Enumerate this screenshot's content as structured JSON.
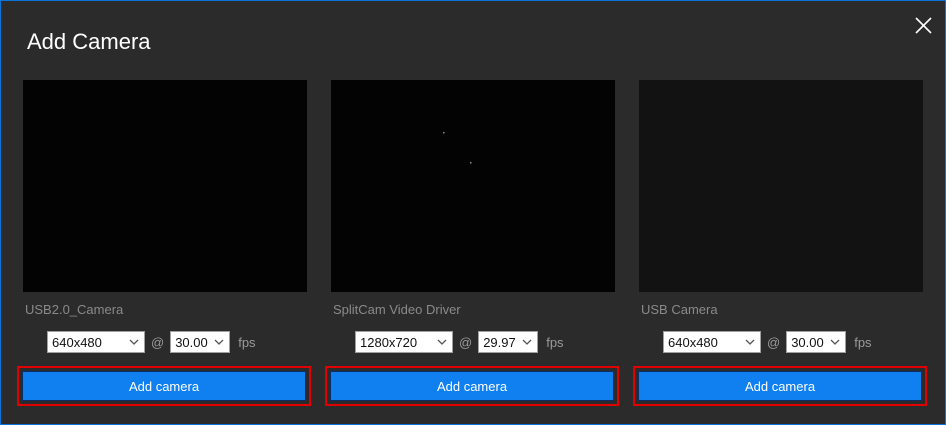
{
  "dialog": {
    "title": "Add Camera",
    "close_icon": "close-icon",
    "accent_color": "#1080f0",
    "highlight_color": "#e00000"
  },
  "cameras": [
    {
      "name": "USB2.0_Camera",
      "resolution": "640x480",
      "at_symbol": "@",
      "fps_value": "30.00",
      "fps_unit": "fps",
      "button_label": "Add camera"
    },
    {
      "name": "SplitCam Video Driver",
      "resolution": "1280x720",
      "at_symbol": "@",
      "fps_value": "29.97",
      "fps_unit": "fps",
      "button_label": "Add camera"
    },
    {
      "name": "USB Camera",
      "resolution": "640x480",
      "at_symbol": "@",
      "fps_value": "30.00",
      "fps_unit": "fps",
      "button_label": "Add camera"
    }
  ]
}
